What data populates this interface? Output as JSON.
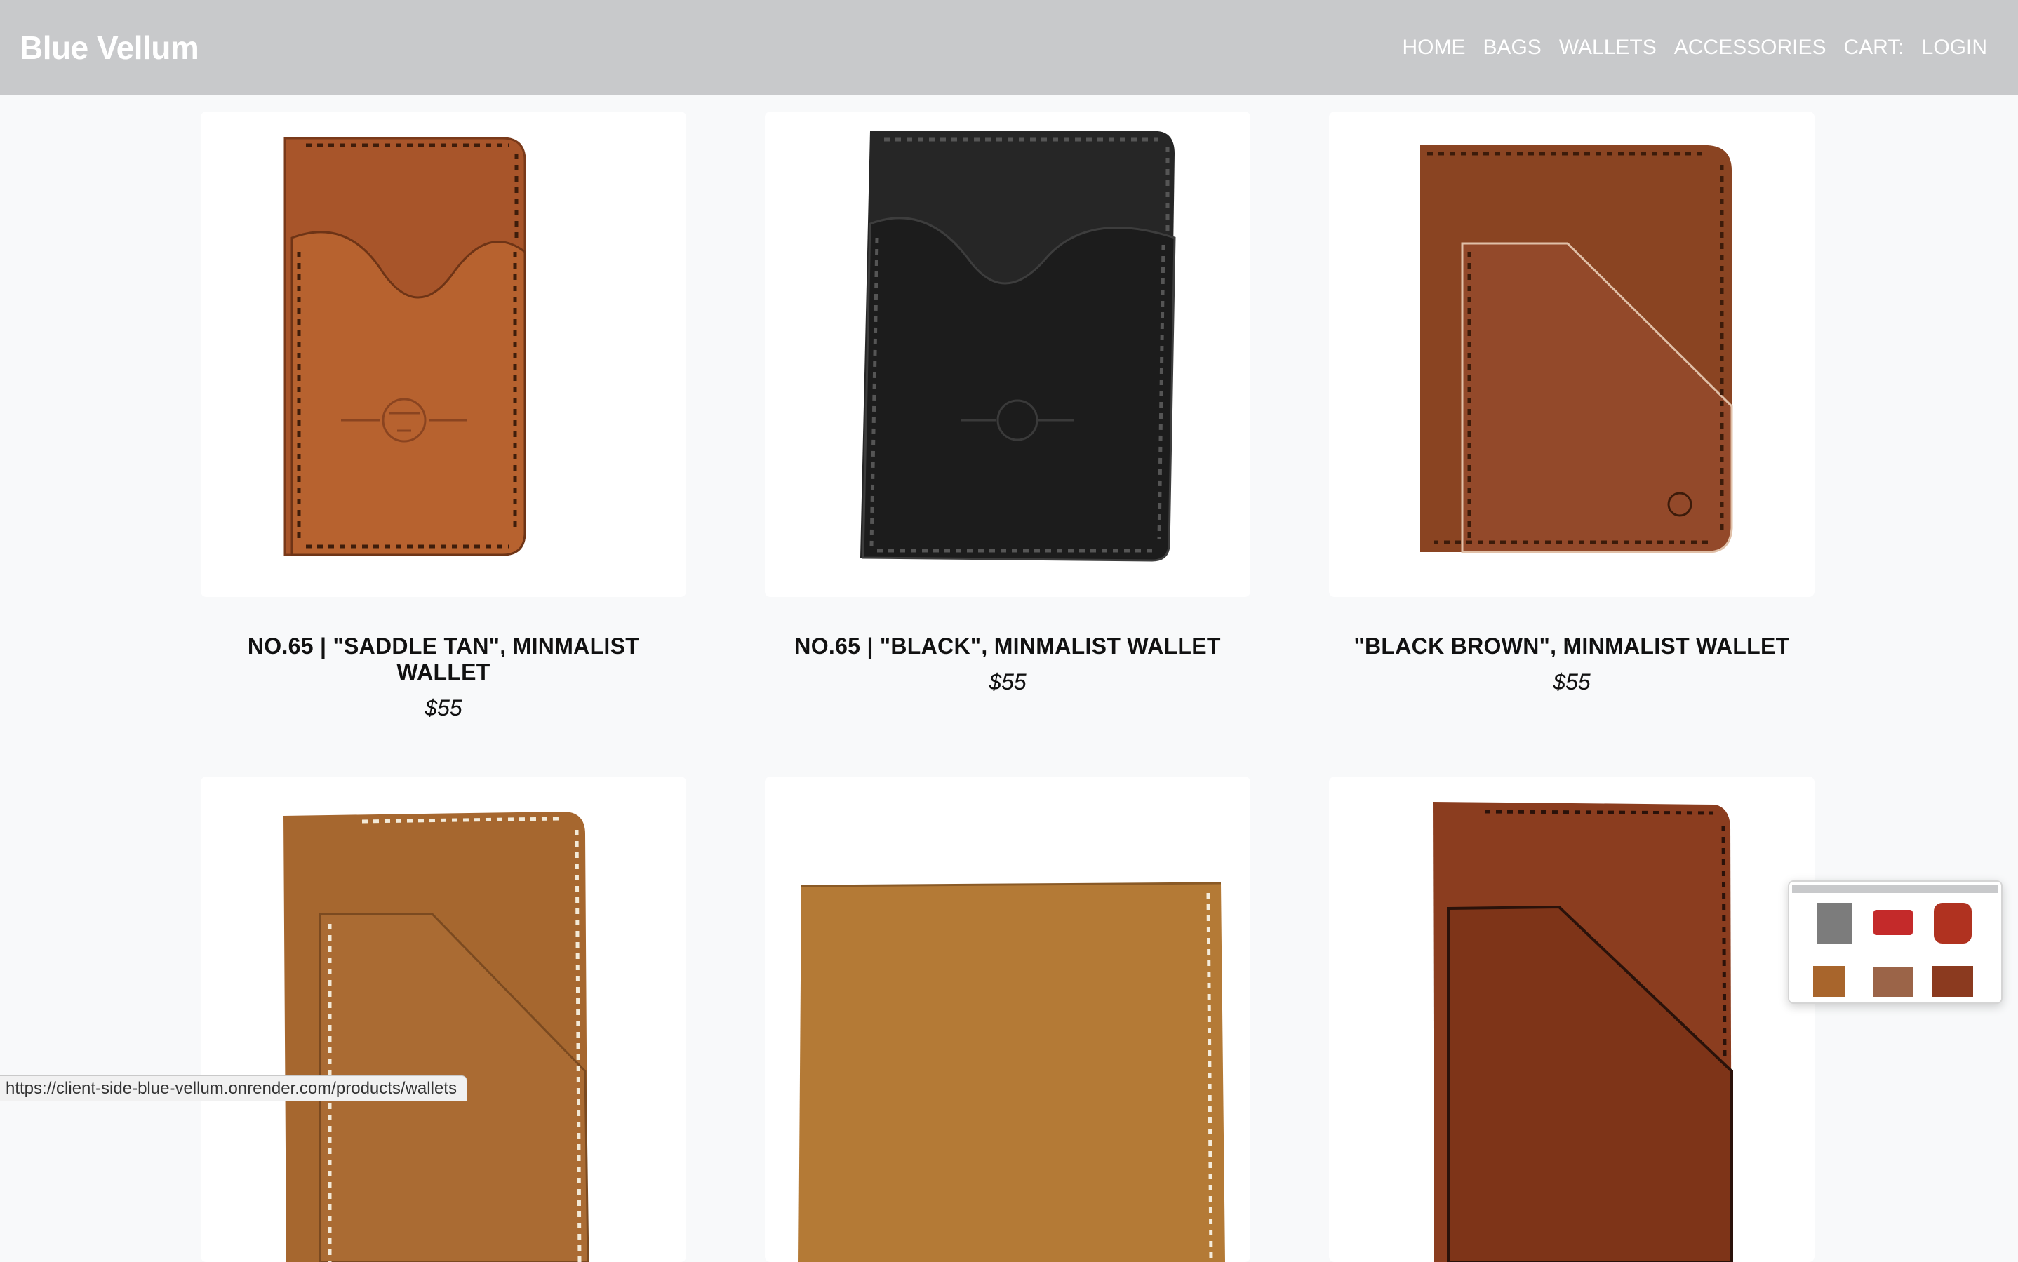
{
  "header": {
    "brand": "Blue Vellum",
    "nav": [
      "HOME",
      "BAGS",
      "WALLETS",
      "ACCESSORIES",
      "CART:",
      "LOGIN"
    ]
  },
  "products": [
    {
      "title": "NO.65 | \"SADDLE TAN\", MINMALIST WALLET",
      "price": "$55",
      "color": "#a8552a"
    },
    {
      "title": "NO.65 | \"BLACK\", MINMALIST WALLET",
      "price": "$55",
      "color": "#262626"
    },
    {
      "title": "\"BLACK BROWN\", MINMALIST WALLET",
      "price": "$55",
      "color": "#8a4422"
    },
    {
      "title": "",
      "price": "",
      "color": "#a6672f"
    },
    {
      "title": "",
      "price": "",
      "color": "#b47a36"
    },
    {
      "title": "",
      "price": "",
      "color": "#8b3d1f"
    }
  ],
  "status_bar": {
    "url": "https://client-side-blue-vellum.onrender.com/products/wallets"
  },
  "colors": {
    "navbar": "#c8c9cb",
    "page_background": "#f8f9fa",
    "card_background": "#ffffff"
  }
}
